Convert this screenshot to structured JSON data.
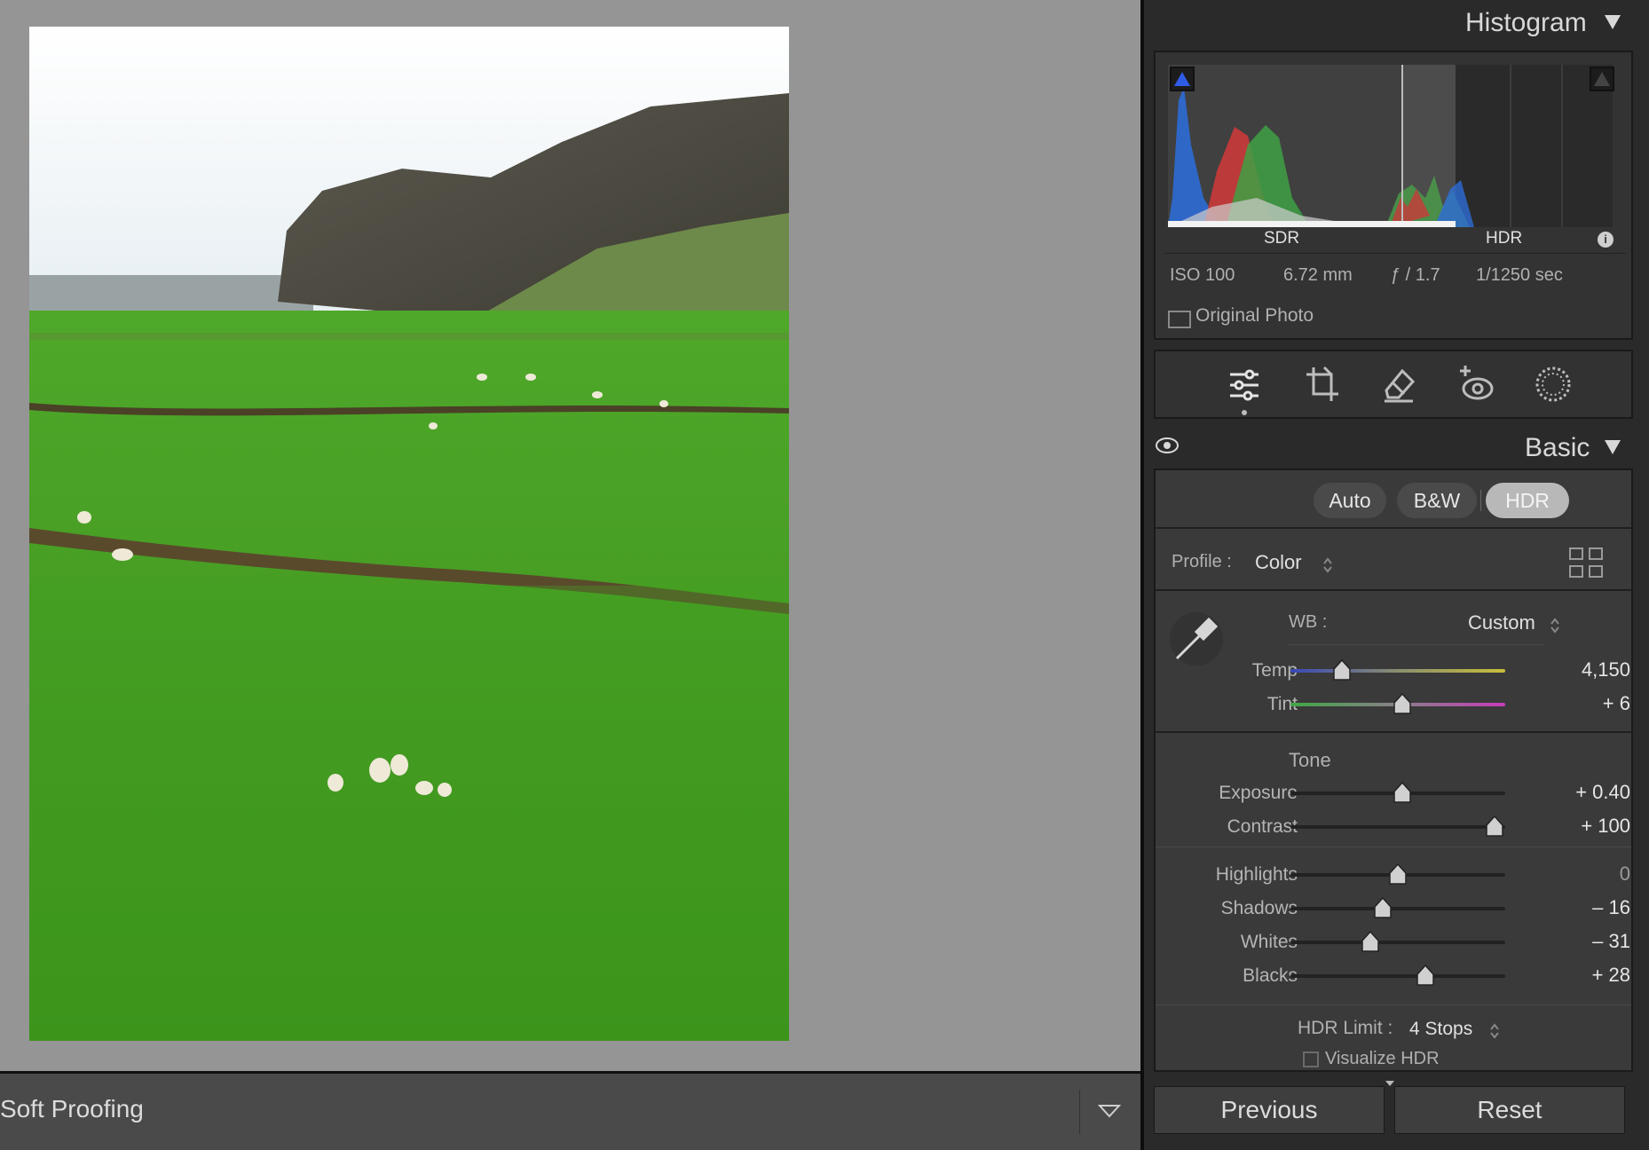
{
  "toolbar": {
    "label": "Soft Proofing"
  },
  "histogram": {
    "title": "Histogram",
    "sdr_label": "SDR",
    "hdr_label": "HDR",
    "info": {
      "iso": "ISO 100",
      "focal": "6.72 mm",
      "aperture": "ƒ / 1.7",
      "shutter": "1/1250 sec"
    },
    "original_photo_label": "Original Photo"
  },
  "tools": [
    "edit-icon",
    "crop-icon",
    "heal-icon",
    "redeye-icon",
    "mask-icon"
  ],
  "basic": {
    "title": "Basic",
    "buttons": {
      "auto": "Auto",
      "bw": "B&W",
      "hdr": "HDR"
    },
    "profile_label": "Profile :",
    "profile_value": "Color",
    "wb_label": "WB :",
    "wb_value": "Custom",
    "temp": {
      "label": "Temp",
      "value": "4,150",
      "pos": 0.24
    },
    "tint": {
      "label": "Tint",
      "value": "+ 6",
      "pos": 0.52
    },
    "tone_label": "Tone",
    "exposure": {
      "label": "Exposure",
      "value": "+ 0.40",
      "pos": 0.52
    },
    "contrast": {
      "label": "Contrast",
      "value": "+ 100",
      "pos": 0.95
    },
    "highlights": {
      "label": "Highlights",
      "value": "0",
      "pos": 0.5
    },
    "shadows": {
      "label": "Shadows",
      "value": "– 16",
      "pos": 0.43
    },
    "whites": {
      "label": "Whites",
      "value": "– 31",
      "pos": 0.37
    },
    "blacks": {
      "label": "Blacks",
      "value": "+ 28",
      "pos": 0.63
    },
    "hdr_limit_label": "HDR Limit :",
    "hdr_limit_value": "4 Stops",
    "visualize_hdr_label": "Visualize HDR"
  },
  "footer": {
    "previous": "Previous",
    "reset": "Reset"
  },
  "colors": {
    "accent_panel": "#2a2a2a",
    "canvas": "#959595"
  }
}
